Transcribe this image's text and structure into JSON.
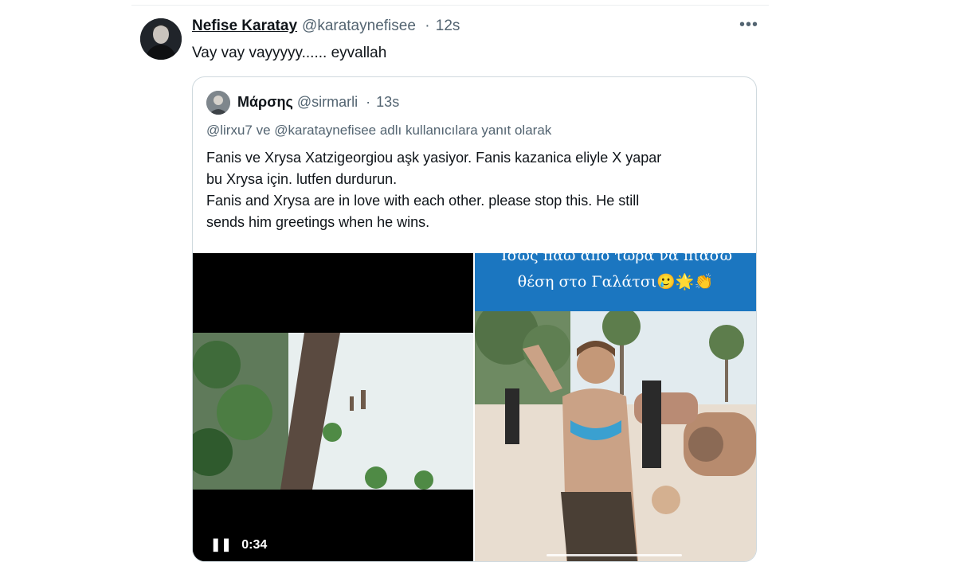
{
  "tweet": {
    "author_name": "Nefise Karatay",
    "author_handle": "@karataynefisee",
    "separator": "·",
    "time": "12s",
    "more_icon": "more-horizontal-icon",
    "more_glyph": "•••",
    "text": "Vay vay vayyyyy...... eyvallah"
  },
  "quote": {
    "author_name": "Μάρσης",
    "author_handle": "@sirmarli",
    "separator": "·",
    "time": "13s",
    "reply_line": "@lirxu7 ve @karataynefisee adlı kullanıcılara yanıt olarak",
    "body_lines": [
      "Fanis ve Xrysa Xatzigeorgiou aşk yasiyor. Fanis kazanica eliyle X yapar",
      "bu Xrysa için. lutfen durdurun.",
      "Fanis and Xrysa are in love with each other. please stop this. He still",
      "sends him greetings when he wins."
    ],
    "video_left": {
      "pause_icon": "pause-icon",
      "pause_glyph": "❚❚",
      "duration": "0:34"
    },
    "video_right": {
      "caption_line1": "Ίσως πάω από τώρα να πιάσω",
      "caption_line2": "θέση στο Γαλάτσι🥲🌟👏"
    }
  },
  "colors": {
    "text": "#0f1419",
    "secondary": "#536471",
    "border": "#cfd9de",
    "caption_band": "#1b76c0"
  }
}
